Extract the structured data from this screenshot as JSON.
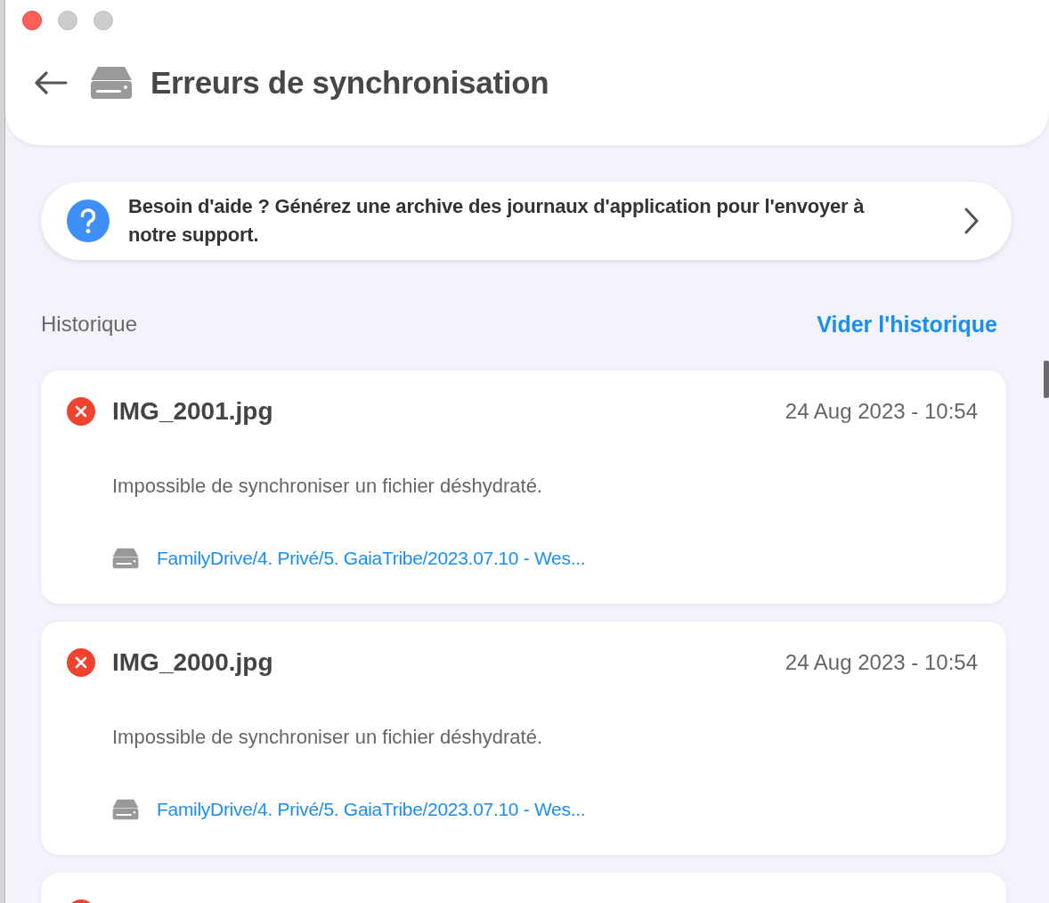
{
  "window": {
    "title": "Erreurs de synchronisation"
  },
  "help_banner": {
    "text": "Besoin d'aide ? Générez une archive des journaux d'application pour l'envoyer à notre support."
  },
  "history": {
    "heading": "Historique",
    "clear_link": "Vider l'historique"
  },
  "errors": [
    {
      "kind": "error",
      "file": "IMG_2001.jpg",
      "date": "24 Aug 2023 - 10:54",
      "message": "Impossible de synchroniser un fichier déshydraté.",
      "path": "FamilyDrive/4. Privé/5. GaiaTribe/2023.07.10 - Wes..."
    },
    {
      "kind": "error",
      "file": "IMG_2000.jpg",
      "date": "24 Aug 2023 - 10:54",
      "message": "Impossible de synchroniser un fichier déshydraté.",
      "path": "FamilyDrive/4. Privé/5. GaiaTribe/2023.07.10 - Wes..."
    },
    {
      "kind": "error"
    }
  ]
}
